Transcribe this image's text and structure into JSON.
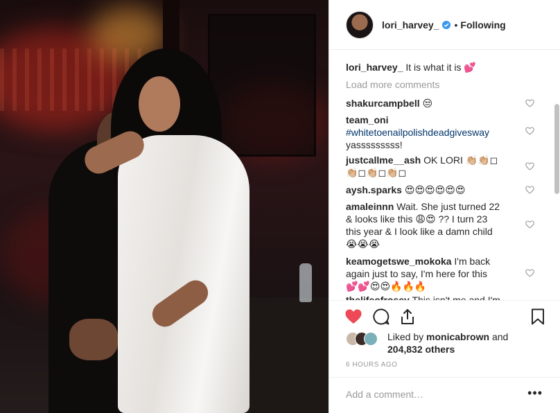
{
  "header": {
    "username": "lori_harvey_",
    "separator": "•",
    "follow_status": "Following"
  },
  "caption": {
    "username": "lori_harvey_",
    "text": "It is what it is 💕"
  },
  "load_more": "Load more comments",
  "comments": [
    {
      "username": "shakurcampbell",
      "text": "😒"
    },
    {
      "username": "team_oni",
      "text": "#whitetoenailpolishdeadgivesway",
      "text2": "yasssssssss!"
    },
    {
      "username": "justcallme__ash",
      "text": "OK LORI 👏🏼👏🏼◻",
      "text2": "👏🏼◻👏🏼◻👏🏼◻"
    },
    {
      "username": "aysh.sparks",
      "text": "😍😍😍😍😍😍"
    },
    {
      "username": "amaleinnn",
      "text": "Wait. She just turned 22",
      "text2": "& looks like this 😩😍 ?? I turn 23",
      "text3": "this year & I look like a damn child",
      "text4": "😭😭😭"
    },
    {
      "username": "keamogetswe_mokoka",
      "text": "I'm back",
      "text2": "again just to say, I'm here for this",
      "text3": "💕💕😍😍🔥🔥🔥"
    },
    {
      "username": "thelifeofrosey",
      "text": "This isn't me and I'm"
    }
  ],
  "likes": {
    "prefix": "Liked by",
    "user": "monicabrown",
    "conjunction": "and",
    "count": "204,832 others"
  },
  "timestamp": "6 HOURS AGO",
  "add_comment": {
    "placeholder": "Add a comment…",
    "more": "•••"
  },
  "colors": {
    "like_red": "#ed4956",
    "verified_blue": "#3897f0",
    "muted": "#999999"
  }
}
